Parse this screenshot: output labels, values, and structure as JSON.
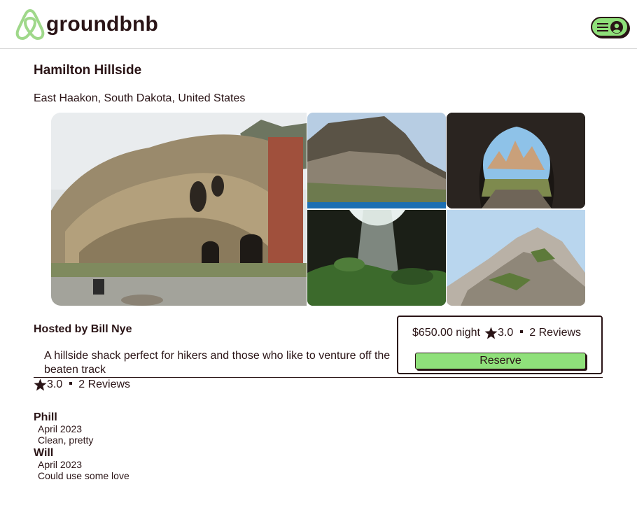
{
  "header": {
    "logo_text": "groundbnb",
    "logo_icon": "airbnb-style-logo-icon",
    "menu_icons": [
      "hamburger-icon",
      "user-circle-icon"
    ]
  },
  "listing": {
    "title": "Hamilton Hillside",
    "location": "East Haakon, South Dakota, United States",
    "photos": [
      "sandstone-cave-house",
      "cliff-dwellings",
      "cave-mountain-view",
      "cave-sunbeam",
      "rocky-slope"
    ],
    "host": "Hosted by Bill Nye",
    "description": "A hillside shack perfect for hikers and those who like to venture off the beaten track",
    "rating": "3.0",
    "review_count": "2 Reviews"
  },
  "booking": {
    "price": "$650.00 night",
    "rating": "3.0",
    "review_count": "2 Reviews",
    "reserve_label": "Reserve"
  },
  "reviews": [
    {
      "name": "Phill",
      "date": "April 2023",
      "text": "Clean, pretty"
    },
    {
      "name": "Will",
      "date": "April 2023",
      "text": "Could use some love"
    }
  ],
  "colors": {
    "text": "#2a1416",
    "accent_green": "#8fe07a",
    "logo_green": "#9fd88a"
  }
}
